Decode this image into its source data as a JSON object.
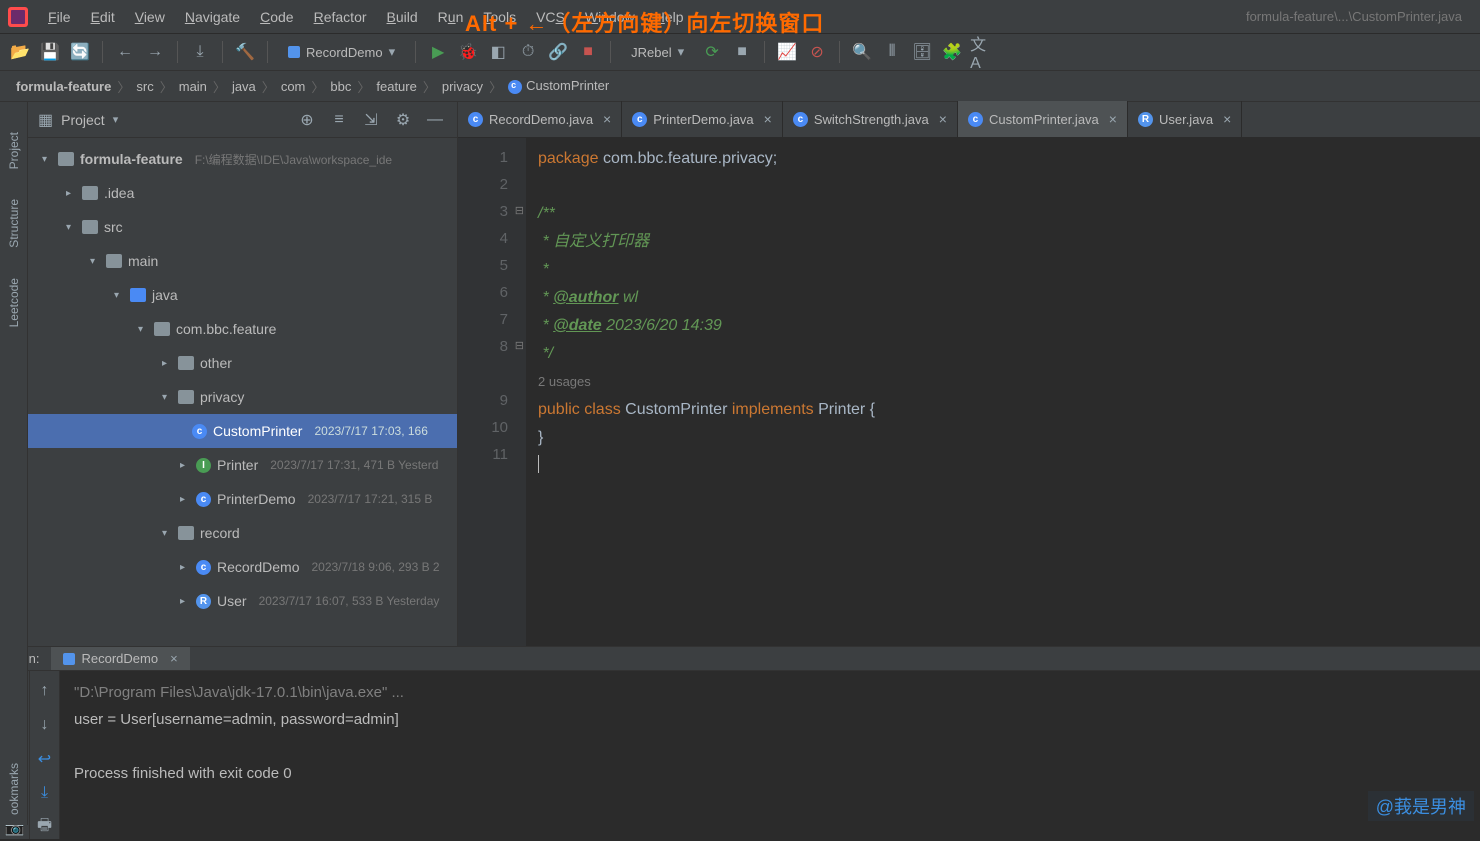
{
  "overlay": "Alt + ←（左方向键）向左切换窗口",
  "title_path": "formula-feature\\...\\CustomPrinter.java",
  "menu": [
    "File",
    "Edit",
    "View",
    "Navigate",
    "Code",
    "Refactor",
    "Build",
    "Run",
    "Tools",
    "VCS",
    "Window",
    "Help"
  ],
  "run_config": "RecordDemo",
  "jrebel": "JRebel",
  "breadcrumb": [
    "formula-feature",
    "src",
    "main",
    "java",
    "com",
    "bbc",
    "feature",
    "privacy",
    "CustomPrinter"
  ],
  "panel": {
    "title": "Project"
  },
  "tree": {
    "root": {
      "name": "formula-feature",
      "path": "F:\\编程数据\\IDE\\Java\\workspace_ide"
    },
    "idea": ".idea",
    "src": "src",
    "main": "main",
    "java": "java",
    "pkg": "com.bbc.feature",
    "other": "other",
    "privacy": "privacy",
    "cp": {
      "name": "CustomPrinter",
      "meta": "2023/7/17 17:03, 166"
    },
    "pr": {
      "name": "Printer",
      "meta": "2023/7/17 17:31, 471 B Yesterd"
    },
    "pd": {
      "name": "PrinterDemo",
      "meta": "2023/7/17 17:21, 315 B"
    },
    "record": "record",
    "rd": {
      "name": "RecordDemo",
      "meta": "2023/7/18 9:06, 293 B 2"
    },
    "user": {
      "name": "User",
      "meta": "2023/7/17 16:07, 533 B Yesterday"
    }
  },
  "tabs": [
    {
      "label": "RecordDemo.java",
      "icon": "c"
    },
    {
      "label": "PrinterDemo.java",
      "icon": "c"
    },
    {
      "label": "SwitchStrength.java",
      "icon": "c"
    },
    {
      "label": "CustomPrinter.java",
      "icon": "c",
      "active": true
    },
    {
      "label": "User.java",
      "icon": "r"
    }
  ],
  "code": {
    "l1a": "package ",
    "l1b": "com.bbc.feature.privacy",
    "l3": "/**",
    "l4": " * 自定义打印器",
    "l5": " *",
    "l6a": " * ",
    "l6b": "@author",
    "l6c": " wl",
    "l7a": " * ",
    "l7b": "@date",
    "l7c": " 2023/6/20 14:39",
    "l8": " */",
    "usages": "2 usages",
    "l9a": "public ",
    "l9b": "class ",
    "l9c": "CustomPrinter ",
    "l9d": "implements ",
    "l9e": "Printer {",
    "l10": "}"
  },
  "line_numbers": [
    "1",
    "2",
    "3",
    "4",
    "5",
    "6",
    "7",
    "8",
    "9",
    "10",
    "11"
  ],
  "run": {
    "label": "Run:",
    "tab": "RecordDemo",
    "line1": "\"D:\\Program Files\\Java\\jdk-17.0.1\\bin\\java.exe\" ...",
    "line2": "user = User[username=admin, password=admin]",
    "line3": "Process finished with exit code 0"
  },
  "side_tools": [
    "Project",
    "Structure",
    "Leetcode"
  ],
  "bookmark_label": "ookmarks",
  "watermark": "@莪是男神"
}
